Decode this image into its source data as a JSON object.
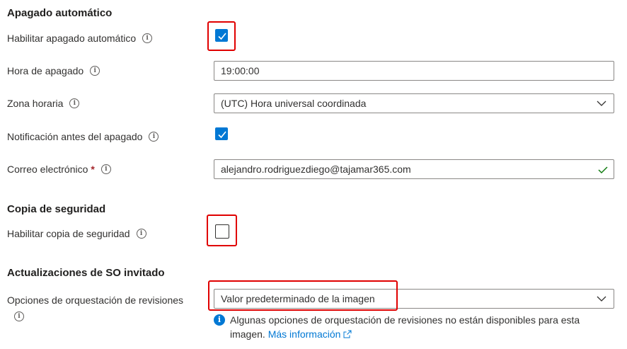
{
  "auto_shutdown": {
    "title": "Apagado automático",
    "enable_label": "Habilitar apagado automático",
    "enable_checked": true,
    "time_label": "Hora de apagado",
    "time_value": "19:00:00",
    "timezone_label": "Zona horaria",
    "timezone_value": "(UTC) Hora universal coordinada",
    "notify_label": "Notificación antes del apagado",
    "notify_checked": true,
    "email_label": "Correo electrónico",
    "email_required": "*",
    "email_value": "alejandro.rodriguezdiego@tajamar365.com"
  },
  "backup": {
    "title": "Copia de seguridad",
    "enable_label": "Habilitar copia de seguridad",
    "enable_checked": false
  },
  "guest_os_updates": {
    "title": "Actualizaciones de SO invitado",
    "orchestration_label": "Opciones de orquestación de revisiones",
    "orchestration_value": "Valor predeterminado de la imagen",
    "info_text": "Algunas opciones de orquestación de revisiones no están disponibles para esta imagen.",
    "info_link": "Más información"
  },
  "icons": {
    "info": "info-icon",
    "check": "checkmark-icon",
    "chevron": "chevron-down-icon",
    "valid": "valid-check-icon",
    "external": "external-link-icon"
  },
  "colors": {
    "accent": "#0078d4",
    "highlight": "#e00000",
    "valid": "#107c10",
    "required": "#a4262c"
  }
}
